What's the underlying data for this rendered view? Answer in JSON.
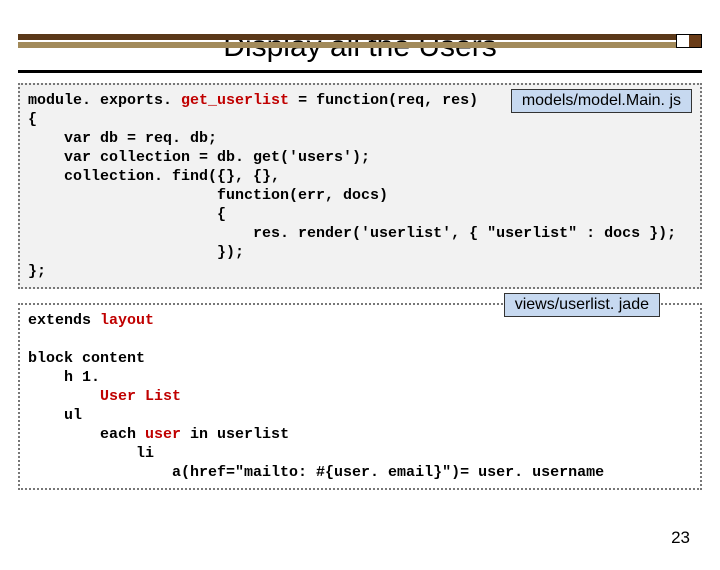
{
  "title": "Display all the Users",
  "box1": {
    "tag": "models/model.Main. js",
    "l1a": "module. exports. ",
    "l1hl": "get_userlist",
    "l1b": " = function(req, res)",
    "l2": "{",
    "l3": "    var db = req. db;",
    "l4": "    var collection = db. get('users');",
    "l5": "    collection. find({}, {},",
    "l6": "                     function(err, docs)",
    "l7": "                     {",
    "l8": "                         res. render('userlist', { \"userlist\" : docs });",
    "l9": "                     });",
    "l10": "};"
  },
  "box2": {
    "tag": "views/userlist. jade",
    "l1a": "extends ",
    "l1hl": "layout",
    "l2": "",
    "l3": "block content",
    "l4": "    h 1.",
    "l5a": "        ",
    "l5hl": "User List",
    "l6": "    ul",
    "l7a": "        each ",
    "l7hl": "user",
    "l7b": " in userlist",
    "l8": "            li",
    "l9": "                a(href=\"mailto: #{user. email}\")= user. username"
  },
  "page_number": "23"
}
